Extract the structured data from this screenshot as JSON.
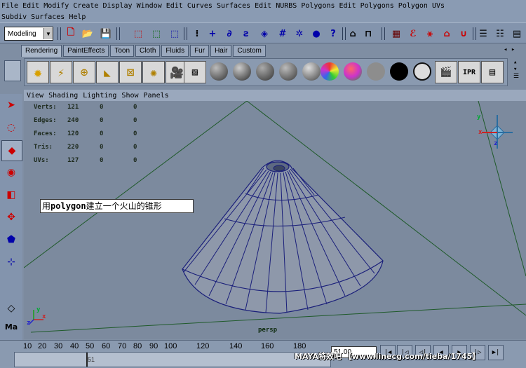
{
  "main_menu": [
    "File",
    "Edit",
    "Modify",
    "Create",
    "Display",
    "Window",
    "Edit Curves",
    "Surfaces",
    "Edit NURBS",
    "Polygons",
    "Edit Polygons",
    "Polygon UVs"
  ],
  "sub_menu": [
    "Subdiv Surfaces",
    "Help"
  ],
  "status_line": {
    "mode": "Modeling"
  },
  "shelf": {
    "tabs": [
      "Rendering",
      "PaintEffects",
      "Toon",
      "Cloth",
      "Fluids",
      "Fur",
      "Hair",
      "Custom"
    ],
    "active_tab": "Rendering"
  },
  "viewport": {
    "menu": [
      "View",
      "Shading",
      "Lighting",
      "Show",
      "Panels"
    ],
    "hud": [
      {
        "label": "Verts:",
        "a": "121",
        "b": "0",
        "c": "0"
      },
      {
        "label": "Edges:",
        "a": "240",
        "b": "0",
        "c": "0"
      },
      {
        "label": "Faces:",
        "a": "120",
        "b": "0",
        "c": "0"
      },
      {
        "label": "Tris:",
        "a": "220",
        "b": "0",
        "c": "0"
      },
      {
        "label": "UVs:",
        "a": "127",
        "b": "0",
        "c": "0"
      }
    ],
    "annotation_prefix": "用",
    "annotation_bold": "polygon",
    "annotation_suffix": "建立一个火山的锥形",
    "camera_label": "persp",
    "axis_labels": {
      "x": "x",
      "y": "y",
      "z": "z"
    },
    "colors": {
      "background": "#7c8a9e",
      "mesh_fill": "#8e98aa",
      "mesh_edges": "#1a1f7a",
      "grid_line": "#1f5a2a"
    }
  },
  "timeline": {
    "ticks": [
      "10",
      "20",
      "30",
      "40",
      "50",
      "60",
      "70",
      "80",
      "90",
      "100",
      "120",
      "140",
      "160",
      "180"
    ],
    "current_frame": "51.00",
    "marker_frame": "51",
    "watermark": "MAYA特效吧 【www.linecg.com/tieba/1745】"
  }
}
